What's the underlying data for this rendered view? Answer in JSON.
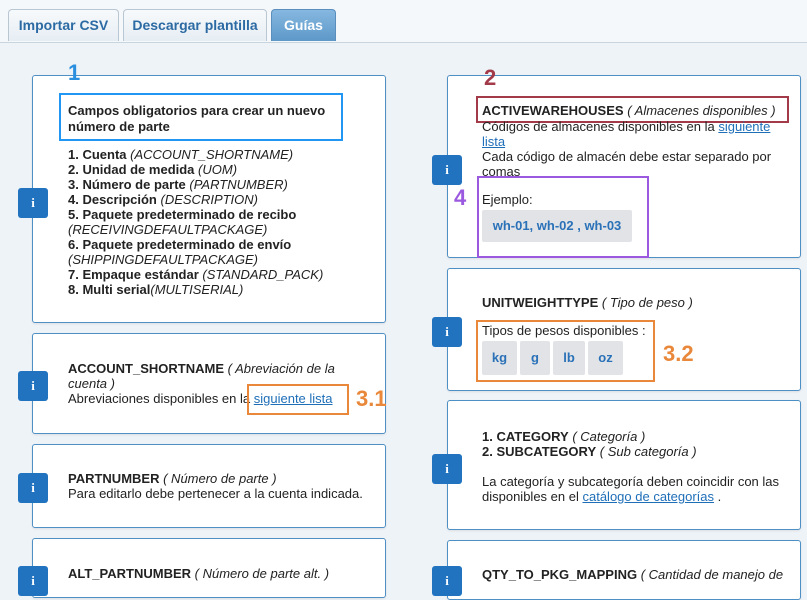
{
  "tabs": {
    "import": "Importar CSV",
    "template": "Descargar plantilla",
    "guides": "Guías"
  },
  "info_icon": "i",
  "card1": {
    "title": "Campos obligatorios para crear un nuevo número de parte",
    "items": [
      {
        "label": "1. Cuenta",
        "code": "(ACCOUNT_SHORTNAME)"
      },
      {
        "label": "2. Unidad de medida",
        "code": "(UOM)"
      },
      {
        "label": "3. Número de parte",
        "code": "(PARTNUMBER)"
      },
      {
        "label": "4. Descripción",
        "code": "(DESCRIPTION)"
      },
      {
        "label": "5. Paquete predeterminado de recibo",
        "code": "(RECEIVINGDEFAULTPACKAGE)"
      },
      {
        "label": "6. Paquete predeterminado de envío",
        "code": "(SHIPPINGDEFAULTPACKAGE)"
      },
      {
        "label": "7. Empaque estándar",
        "code": "(STANDARD_PACK)"
      },
      {
        "label": "8. Multi serial",
        "code": "(MULTISERIAL)"
      }
    ]
  },
  "card_account": {
    "field": "ACCOUNT_SHORTNAME",
    "desc": "( Abreviación de la cuenta )",
    "text": "Abreviaciones disponibles en la",
    "link": "siguiente lista"
  },
  "card_part": {
    "field": "PARTNUMBER",
    "desc": "( Número de parte )",
    "text": "Para editarlo debe pertenecer a la cuenta indicada."
  },
  "card_alt": {
    "field": "ALT_PARTNUMBER",
    "desc": "( Número de parte alt. )"
  },
  "card_wh": {
    "field": "ACTIVEWAREHOUSES",
    "desc": "( Almacenes disponibles )",
    "text1": "Códigos de almacenes disponibles en la",
    "link": "siguiente lista",
    "text2": "Cada código de almacén debe estar separado por comas",
    "example_label": "Ejemplo:",
    "example_value": "wh-01, wh-02 , wh-03"
  },
  "card_weight": {
    "field": "UNITWEIGHTTYPE",
    "desc": "( Tipo de peso )",
    "types_label": "Tipos de pesos disponibles :",
    "types": [
      "kg",
      "g",
      "lb",
      "oz"
    ]
  },
  "card_cat": {
    "field1": "1. CATEGORY",
    "desc1": "( Categoría )",
    "field2": "2. SUBCATEGORY",
    "desc2": "( Sub categoría )",
    "text": "La categoría y subcategoría deben coincidir con las disponibles en el",
    "link": "catálogo de categorías",
    "text_end": "."
  },
  "card_qty": {
    "field": "QTY_TO_PKG_MAPPING",
    "desc": "( Cantidad de manejo de"
  },
  "annotations": {
    "n1": "1",
    "n2": "2",
    "n31": "3.1",
    "n32": "3.2",
    "n4": "4"
  },
  "colors": {
    "primary": "#2173c0",
    "box1": "#2196f3",
    "box2": "#a33a4a",
    "box3": "#e9883a",
    "box4": "#9b59e0"
  }
}
